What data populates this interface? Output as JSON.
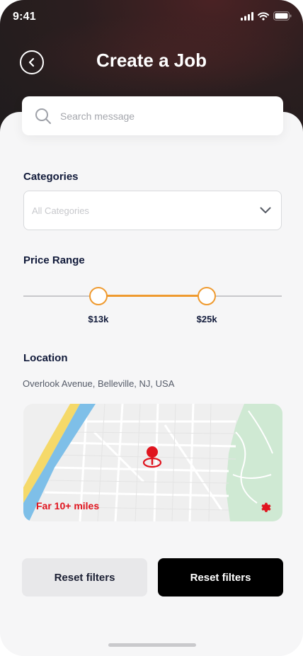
{
  "status_bar": {
    "time": "9:41"
  },
  "header": {
    "title": "Create a Job",
    "back_icon": "chevron-left-icon"
  },
  "search": {
    "placeholder": "Search message",
    "value": ""
  },
  "categories": {
    "label": "Categories",
    "selected": "All Categories"
  },
  "price_range": {
    "label": "Price Range",
    "min_label": "$13k",
    "max_label": "$25k",
    "accent": "#ef9a2f",
    "low_fraction": 0.29,
    "high_fraction": 0.71
  },
  "location": {
    "label": "Location",
    "address": "Overlook Avenue, Belleville, NJ, USA",
    "map_note": "Far 10+ miles",
    "pin_color": "#e0141e"
  },
  "actions": {
    "secondary_label": "Reset filters",
    "primary_label": "Reset filters"
  }
}
